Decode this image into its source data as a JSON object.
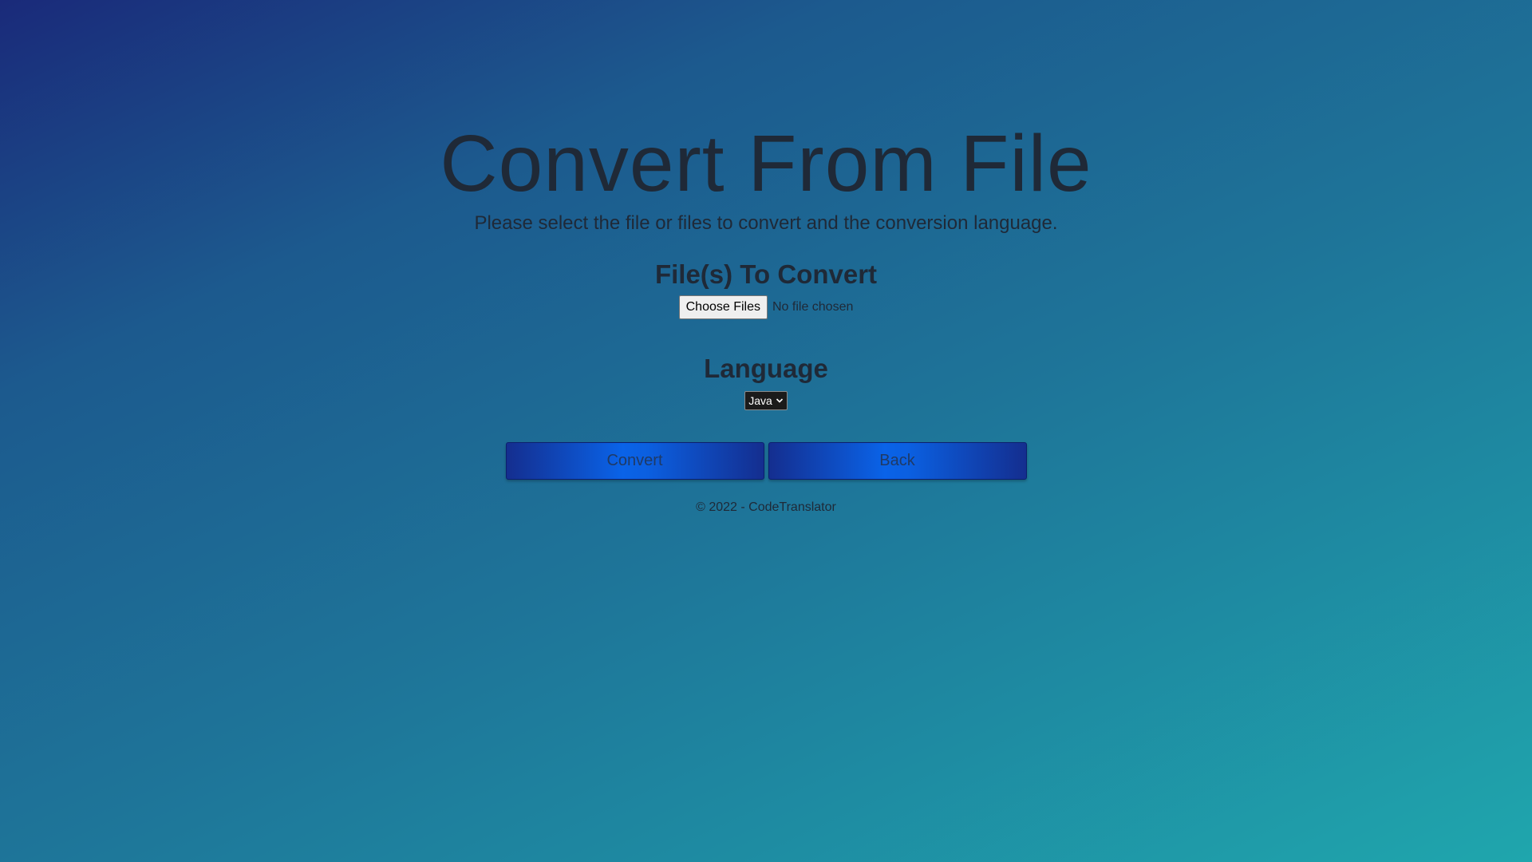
{
  "page": {
    "title": "Convert From File",
    "subtitle": "Please select the file or files to convert and the conversion language."
  },
  "files_section": {
    "heading": "File(s) To Convert",
    "choose_button_label": "Choose Files",
    "no_file_text": "No file chosen"
  },
  "language_section": {
    "heading": "Language",
    "selected": "Java"
  },
  "actions": {
    "convert_label": "Convert",
    "back_label": "Back"
  },
  "footer": {
    "text": "© 2022 - CodeTranslator"
  },
  "colors": {
    "background_start": "#1a2a7a",
    "background_end": "#1fa6ad",
    "button_gradient_center": "#0a63e8",
    "button_gradient_edge": "#142e8f",
    "text": "#1f2937"
  }
}
